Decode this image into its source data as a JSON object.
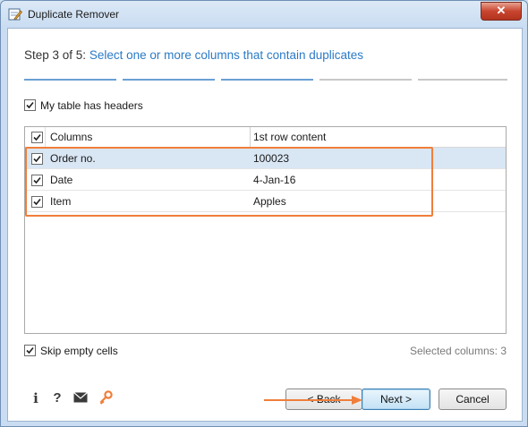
{
  "window": {
    "title": "Duplicate Remover",
    "close_glyph": "✕"
  },
  "step": {
    "prefix": "Step 3 of 5:",
    "description": "Select one or more columns that contain duplicates"
  },
  "progress": {
    "total_steps": 5,
    "current_step": 3
  },
  "options": {
    "has_headers_label": "My table has headers",
    "has_headers_checked": true,
    "skip_empty_label": "Skip empty cells",
    "skip_empty_checked": true
  },
  "table": {
    "headers": {
      "columns": "Columns",
      "first_row": "1st row content"
    },
    "rows": [
      {
        "column": "Order no.",
        "content": "100023",
        "checked": true,
        "selected": true
      },
      {
        "column": "Date",
        "content": "4-Jan-16",
        "checked": true,
        "selected": false
      },
      {
        "column": "Item",
        "content": "Apples",
        "checked": true,
        "selected": false
      }
    ]
  },
  "status": {
    "selected_columns": "Selected columns: 3"
  },
  "footer_icons": [
    {
      "name": "info-icon",
      "glyph": "i"
    },
    {
      "name": "help-icon",
      "glyph": "?"
    },
    {
      "name": "mail-icon",
      "glyph": "✉"
    },
    {
      "name": "key-icon",
      "glyph": "🔑"
    }
  ],
  "buttons": {
    "back": "< Back",
    "next": "Next >",
    "cancel": "Cancel"
  },
  "colors": {
    "accent_blue": "#2b7ac6",
    "highlight_orange": "#f07e3a",
    "selected_row": "#d9e6f4"
  }
}
